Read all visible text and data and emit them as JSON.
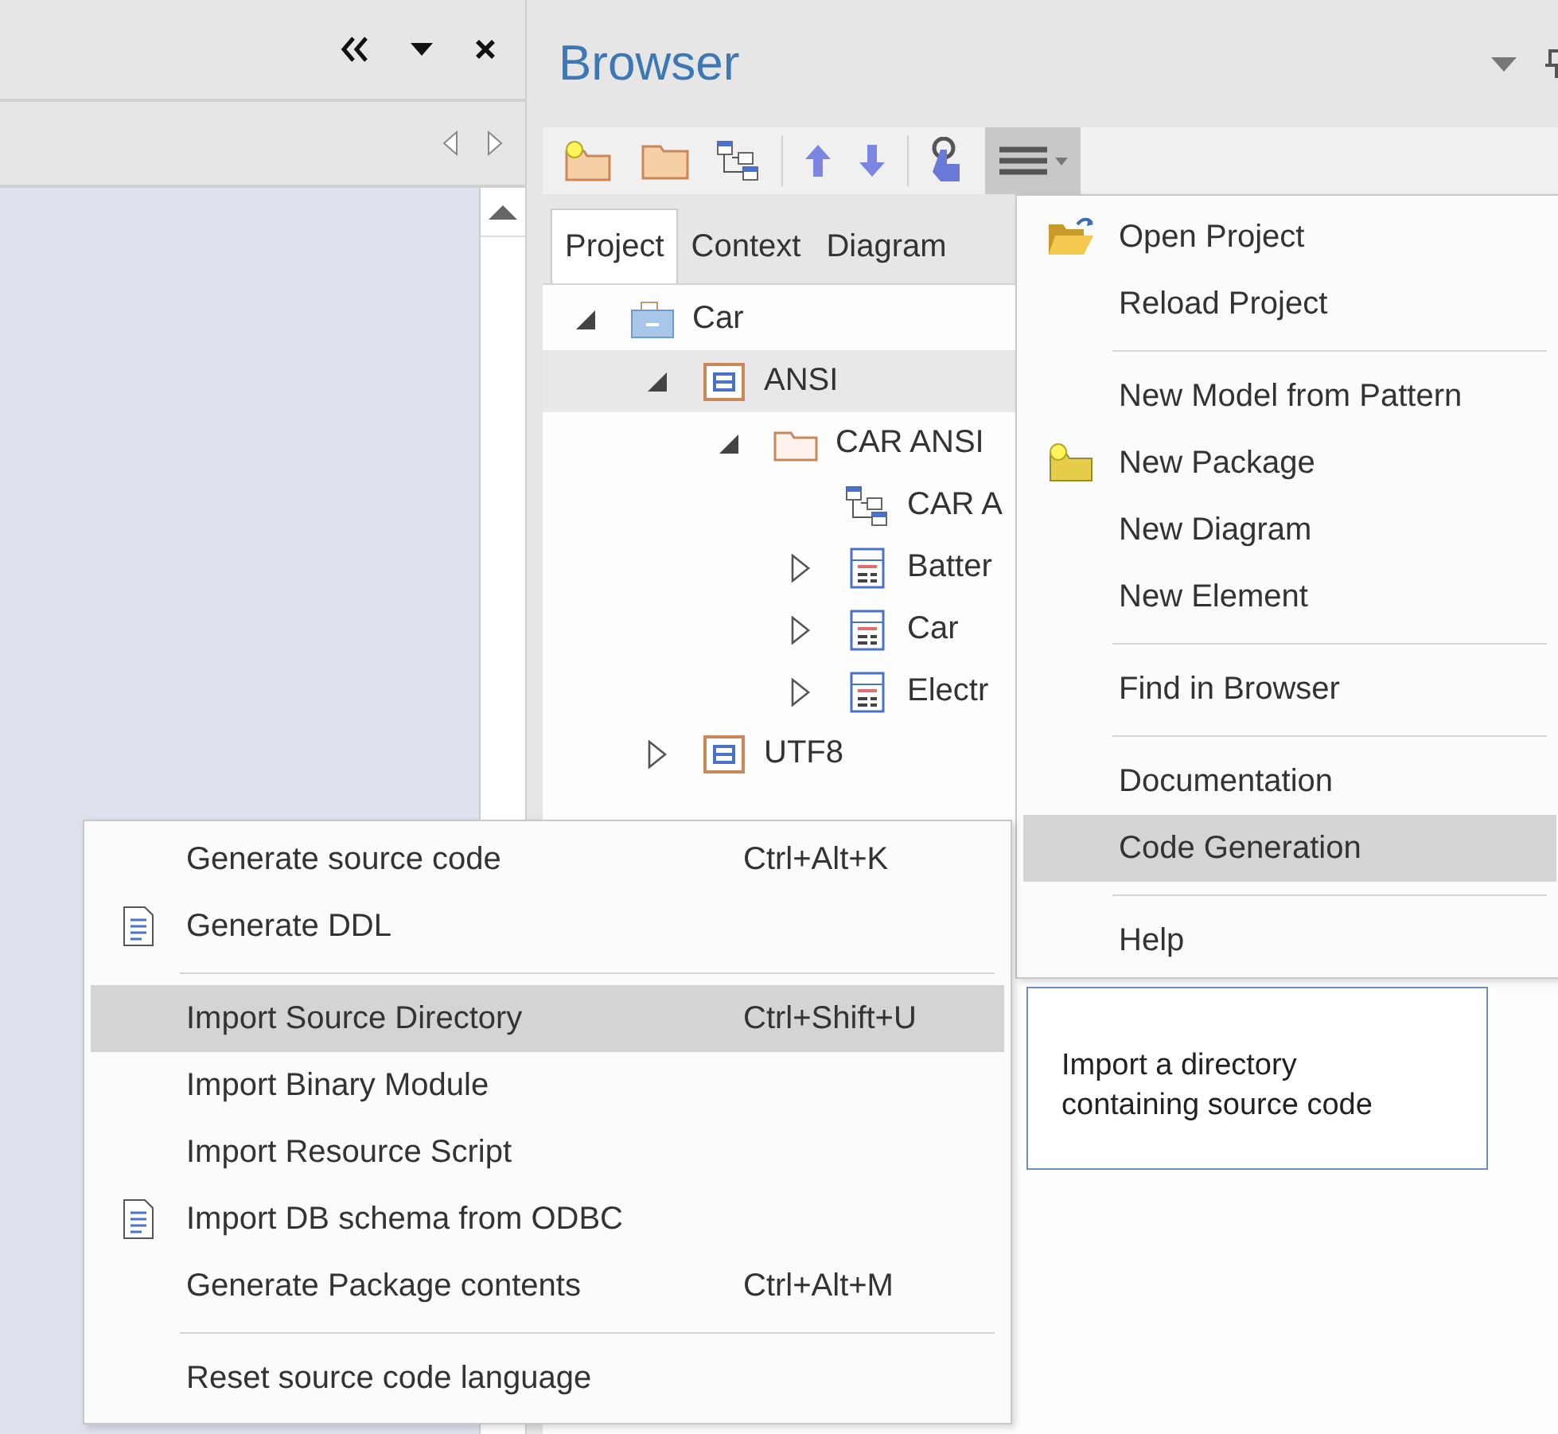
{
  "panel": {
    "title": "Browser"
  },
  "toolbar": {
    "menu_pressed": true
  },
  "tabs": [
    {
      "label": "Project",
      "selected": true
    },
    {
      "label": "Context",
      "selected": false
    },
    {
      "label": "Diagram",
      "selected": false
    }
  ],
  "tree": [
    {
      "label": "Car",
      "kind": "model",
      "expanded": true,
      "selected": false,
      "children": [
        {
          "label": "ANSI",
          "kind": "package",
          "expanded": true,
          "selected": true,
          "children": [
            {
              "label": "CAR ANSI",
              "kind": "folder",
              "expanded": true,
              "selected": false,
              "children": [
                {
                  "label": "CAR A",
                  "kind": "diagram",
                  "selected": false
                },
                {
                  "label": "Batter",
                  "kind": "class",
                  "expanded": false,
                  "selected": false
                },
                {
                  "label": "Car",
                  "kind": "class",
                  "expanded": false,
                  "selected": false
                },
                {
                  "label": "Electr",
                  "kind": "class",
                  "expanded": false,
                  "selected": false
                }
              ]
            }
          ]
        },
        {
          "label": "UTF8",
          "kind": "package",
          "expanded": false,
          "selected": false
        }
      ]
    }
  ],
  "menu": {
    "items": [
      {
        "kind": "folder",
        "label": "Open Project",
        "selected": false
      },
      {
        "kind": "item",
        "label": "Reload Project",
        "selected": false
      },
      {
        "kind": "separator"
      },
      {
        "kind": "item",
        "label": "New Model from Pattern",
        "selected": false
      },
      {
        "kind": "package",
        "label": "New Package",
        "selected": false
      },
      {
        "kind": "item",
        "label": "New Diagram",
        "selected": false
      },
      {
        "kind": "item",
        "label": "New Element",
        "selected": false
      },
      {
        "kind": "separator"
      },
      {
        "kind": "item",
        "label": "Find in Browser",
        "selected": false
      },
      {
        "kind": "separator"
      },
      {
        "kind": "item",
        "label": "Documentation",
        "selected": false
      },
      {
        "kind": "item",
        "label": "Code Generation",
        "selected": true
      },
      {
        "kind": "separator"
      },
      {
        "kind": "item",
        "label": "Help",
        "selected": false
      }
    ]
  },
  "submenu": {
    "items": [
      {
        "kind": "item",
        "label": "Generate source code",
        "shortcut": "Ctrl+Alt+K",
        "selected": false
      },
      {
        "kind": "document",
        "label": "Generate DDL",
        "selected": false
      },
      {
        "kind": "separator"
      },
      {
        "kind": "item",
        "label": "Import Source Directory",
        "shortcut": "Ctrl+Shift+U",
        "selected": true
      },
      {
        "kind": "item",
        "label": "Import Binary Module",
        "selected": false
      },
      {
        "kind": "item",
        "label": "Import Resource Script",
        "selected": false
      },
      {
        "kind": "document",
        "label": "Import DB schema from ODBC",
        "selected": false
      },
      {
        "kind": "item",
        "label": "Generate Package contents",
        "shortcut": "Ctrl+Alt+M",
        "selected": false
      },
      {
        "kind": "separator"
      },
      {
        "kind": "item",
        "label": "Reset source code language",
        "selected": false
      }
    ]
  },
  "tooltip": {
    "text": "Import a directory containing source code"
  }
}
